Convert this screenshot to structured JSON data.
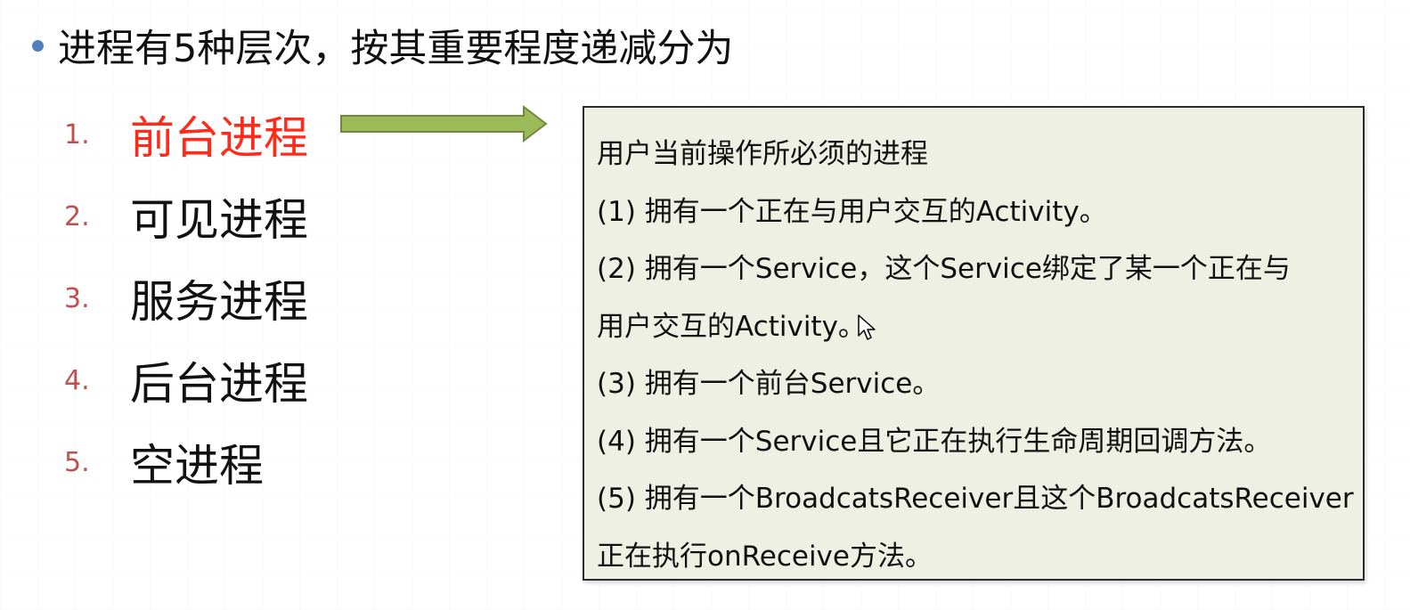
{
  "headline": "进程有5种层次，按其重要程度递减分为",
  "processes": [
    {
      "number": "1.",
      "name": "前台进程"
    },
    {
      "number": "2.",
      "name": "可见进程"
    },
    {
      "number": "3.",
      "name": "服务进程"
    },
    {
      "number": "4.",
      "name": "后台进程"
    },
    {
      "number": "5.",
      "name": "空进程"
    }
  ],
  "description": {
    "lines": [
      "用户当前操作所必须的进程",
      "(1) 拥有一个正在与用户交互的Activity。",
      "(2) 拥有一个Service，这个Service绑定了某一个正在与",
      "用户交互的Activity。",
      "(3) 拥有一个前台Service。",
      "(4) 拥有一个Service且它正在执行生命周期回调方法。",
      "(5) 拥有一个BroadcatsReceiver且这个BroadcatsReceiver",
      "正在执行onReceive方法。"
    ]
  },
  "colors": {
    "bullet": "#4f81bd",
    "number": "#c0504d",
    "highlight": "#ff2a1a",
    "arrow_fill": "#9bbb59",
    "arrow_stroke": "#71893f",
    "box_fill": "#eff0e4"
  }
}
